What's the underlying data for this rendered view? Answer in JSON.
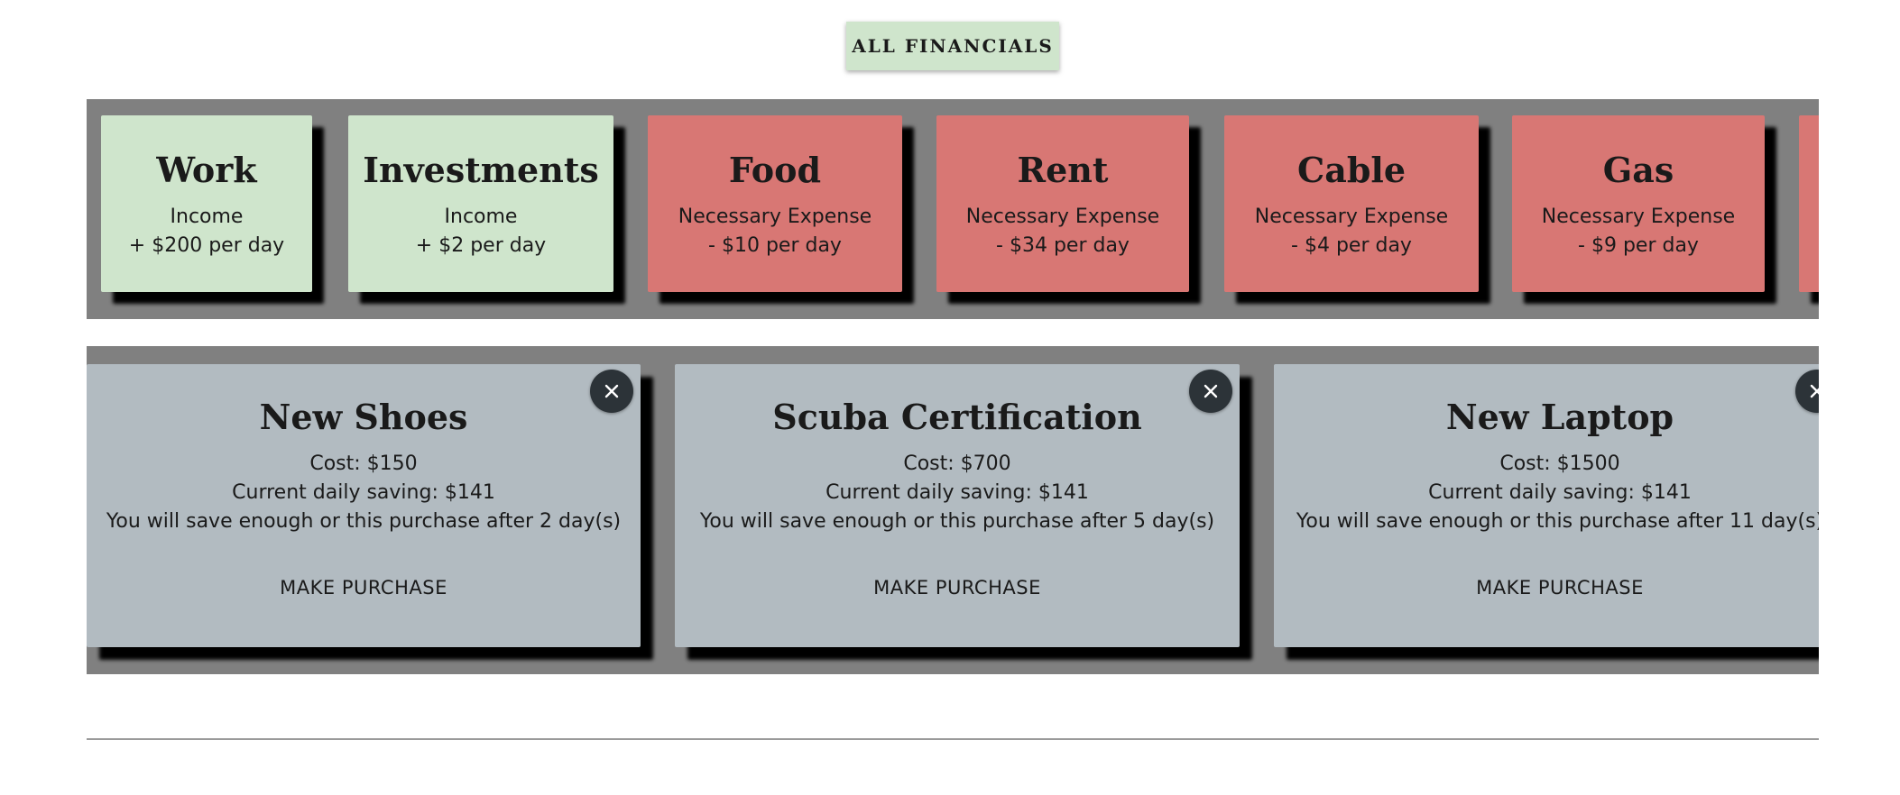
{
  "header": {
    "all_financials_label": "ALL FINANCIALS"
  },
  "financials": [
    {
      "name": "Work",
      "type": "Income",
      "amount": "+ $200 per day"
    },
    {
      "name": "Investments",
      "type": "Income",
      "amount": "+ $2 per day"
    },
    {
      "name": "Food",
      "type": "Necessary Expense",
      "amount": "- $10 per day"
    },
    {
      "name": "Rent",
      "type": "Necessary Expense",
      "amount": "- $34 per day"
    },
    {
      "name": "Cable",
      "type": "Necessary Expense",
      "amount": "- $4 per day"
    },
    {
      "name": "Gas",
      "type": "Necessary Expense",
      "amount": "- $9 per day"
    }
  ],
  "purchases": [
    {
      "name": "New Shoes",
      "cost": "Cost: $150",
      "saving": "Current daily saving: $141",
      "eta": "You will save enough or this purchase after 2 day(s)",
      "button": "MAKE PURCHASE"
    },
    {
      "name": "Scuba Certification",
      "cost": "Cost: $700",
      "saving": "Current daily saving: $141",
      "eta": "You will save enough or this purchase after 5 day(s)",
      "button": "MAKE PURCHASE"
    },
    {
      "name": "New Laptop",
      "cost": "Cost: $1500",
      "saving": "Current daily saving: $141",
      "eta": "You will save enough or this purchase after 11 day(s)",
      "button": "MAKE PURCHASE"
    }
  ],
  "colors": {
    "income": "#cfe5cc",
    "expense": "#d87774",
    "purchase": "#b2bbc1",
    "strip": "#808080",
    "close": "#2c3338"
  },
  "icons": {
    "close": "close-icon"
  }
}
